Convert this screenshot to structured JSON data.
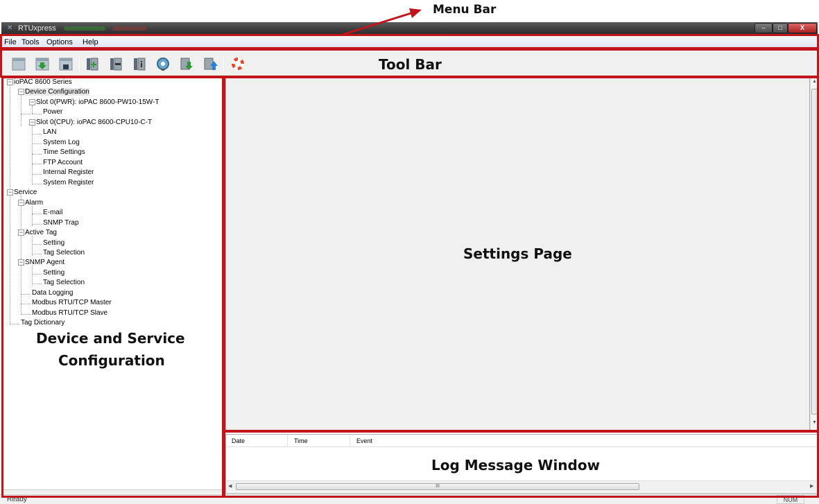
{
  "window": {
    "title": "RTUxpress",
    "controls": {
      "minimize": "–",
      "maximize": "□",
      "close": "X"
    }
  },
  "menu": [
    "File",
    "Tools",
    "Options",
    "Help"
  ],
  "toolbar": {
    "icons": [
      "new-icon",
      "import-icon",
      "save-icon",
      "add-module-icon",
      "remove-module-icon",
      "info-module-icon",
      "find-icon",
      "download-icon",
      "upload-icon",
      "help-lifebuoy-icon"
    ]
  },
  "tree": {
    "items": [
      "ioPAC 8600 Series",
      "Device Configuration",
      "Slot 0(PWR): ioPAC 8600-PW10-15W-T",
      "Power",
      "Slot 0(CPU): ioPAC 8600-CPU10-C-T",
      "LAN",
      "System Log",
      "Time Settings",
      "FTP Account",
      "Internal Register",
      "System Register",
      "Service",
      "Alarm",
      "E-mail",
      "SNMP Trap",
      "Active Tag",
      "Setting",
      "Tag Selection",
      "SNMP Agent",
      "Setting",
      "Tag Selection",
      "Data Logging",
      "Modbus RTU/TCP Master",
      "Modbus RTU/TCP Slave",
      "Tag Dictionary"
    ]
  },
  "log": {
    "columns": [
      "Date",
      "Time",
      "Event"
    ],
    "hscroll_glyph": "III"
  },
  "statusbar": {
    "text": "Ready",
    "num": "NUM"
  },
  "annotations": {
    "menu_bar": "Menu Bar",
    "tool_bar": "Tool Bar",
    "tree_line1": "Device and Service",
    "tree_line2": "Configuration",
    "settings": "Settings Page",
    "log": "Log Message Window"
  },
  "colors": {
    "annotation_red": "#c0161b",
    "titlebar": "#3d3d3d",
    "panel_bg": "#f0f0f0"
  }
}
